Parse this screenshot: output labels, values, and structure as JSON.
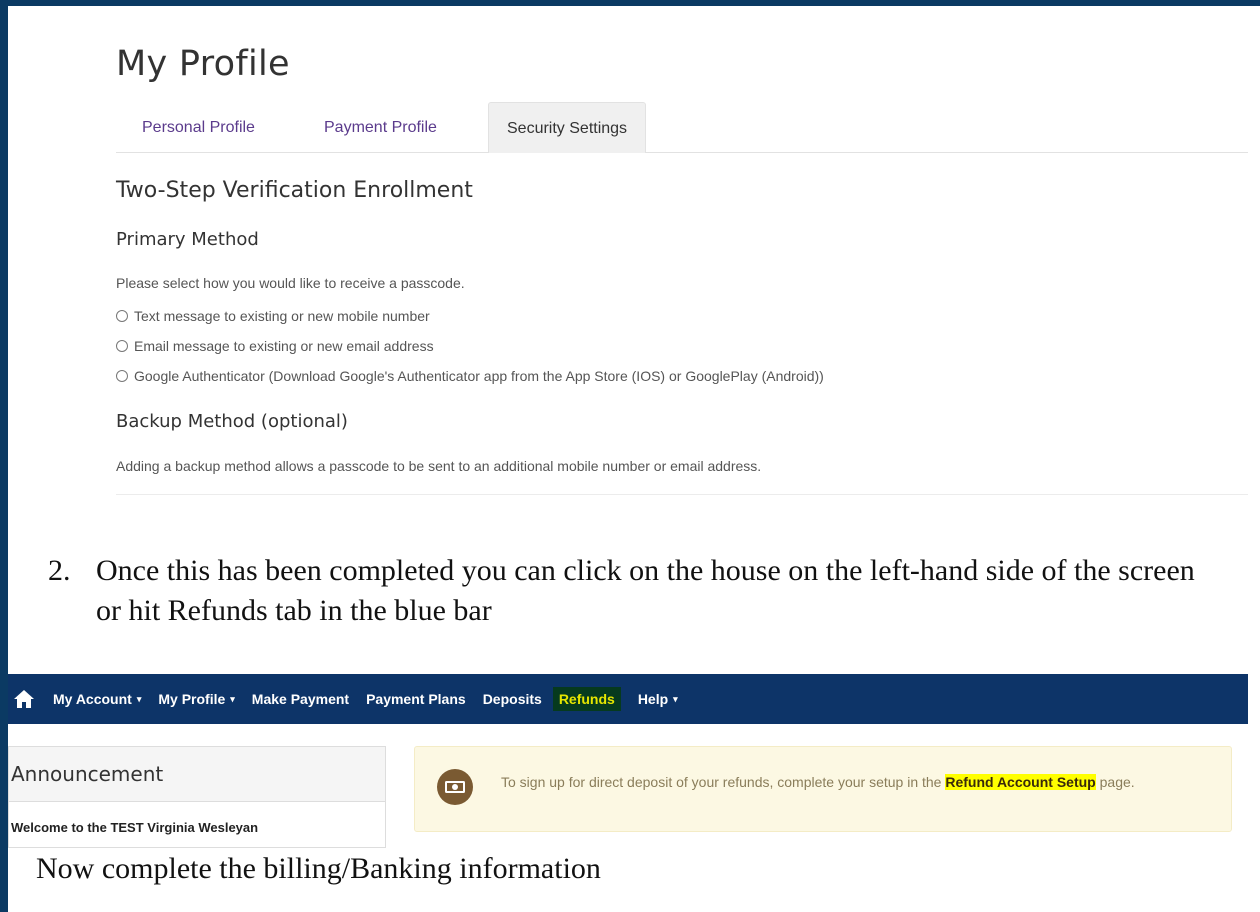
{
  "profile": {
    "title": "My Profile",
    "tabs": [
      {
        "label": "Personal Profile"
      },
      {
        "label": "Payment Profile"
      },
      {
        "label": "Security Settings"
      }
    ],
    "enrollment": {
      "heading": "Two-Step Verification Enrollment",
      "primary_heading": "Primary Method",
      "primary_desc": "Please select how you would like to receive a passcode.",
      "options": [
        "Text message to existing or new mobile number",
        "Email message to existing or new email address",
        "Google Authenticator (Download Google's Authenticator app from the App Store (IOS) or GooglePlay (Android))"
      ],
      "backup_heading": "Backup Method (optional)",
      "backup_desc": "Adding a backup method allows a passcode to be sent to an additional mobile number or email address."
    }
  },
  "instructions": {
    "step_number": "2.",
    "step_text": "Once this has been completed you can click on the house on the left-hand side of the screen or hit Refunds tab in the blue bar",
    "bottom_note": "Now complete the billing/Banking information"
  },
  "navbar": {
    "home_icon": "home-icon",
    "items": [
      {
        "label": "My Account"
      },
      {
        "label": "My Profile"
      },
      {
        "label": "Make Payment"
      },
      {
        "label": "Payment Plans"
      },
      {
        "label": "Deposits"
      },
      {
        "label": "Refunds"
      },
      {
        "label": "Help"
      }
    ],
    "caret": "▾",
    "bar_color": "#0d3468",
    "highlight_color": "#e6e600"
  },
  "announcement": {
    "title": "Announcement",
    "text": "Welcome to the TEST Virginia Wesleyan"
  },
  "alert": {
    "icon": "cash-icon",
    "text_before": "To sign up for direct deposit of your refunds, complete your setup in the ",
    "link": "Refund Account Setup",
    "text_after": " page.",
    "background": "#fcf8e3"
  }
}
